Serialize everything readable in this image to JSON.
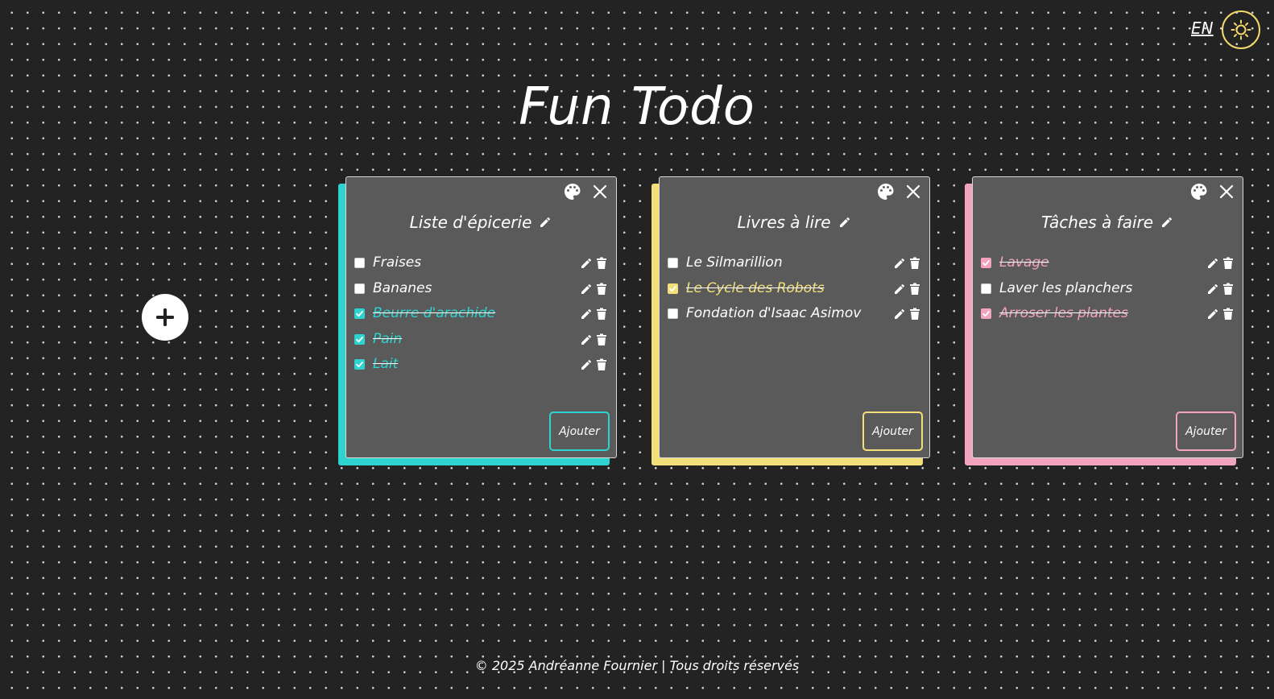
{
  "header": {
    "lang_label": "EN",
    "theme_icon": "sun-icon",
    "accent": "#f3d86b"
  },
  "app_title": "Fun Todo",
  "add_list": {
    "icon": "plus-icon"
  },
  "lists": [
    {
      "title": "Liste d'épicerie",
      "color": "#2ed3cf",
      "add_label": "Ajouter",
      "items": [
        {
          "text": "Fraises",
          "done": false
        },
        {
          "text": "Bananes",
          "done": false
        },
        {
          "text": "Beurre d'arachide",
          "done": true
        },
        {
          "text": "Pain",
          "done": true
        },
        {
          "text": "Lait",
          "done": true
        }
      ]
    },
    {
      "title": "Livres à lire",
      "color": "#f4e07a",
      "add_label": "Ajouter",
      "items": [
        {
          "text": "Le Silmarillion",
          "done": false
        },
        {
          "text": "Le Cycle des Robots",
          "done": true
        },
        {
          "text": "Fondation d'Isaac Asimov",
          "done": false
        }
      ]
    },
    {
      "title": "Tâches à faire",
      "color": "#f2a3bd",
      "add_label": "Ajouter",
      "items": [
        {
          "text": "Lavage",
          "done": true
        },
        {
          "text": "Laver les planchers",
          "done": false
        },
        {
          "text": "Arroser les plantes",
          "done": true
        }
      ]
    }
  ],
  "footer": {
    "text": "© 2025 Andréanne Fournier | Tous droits réservés"
  }
}
